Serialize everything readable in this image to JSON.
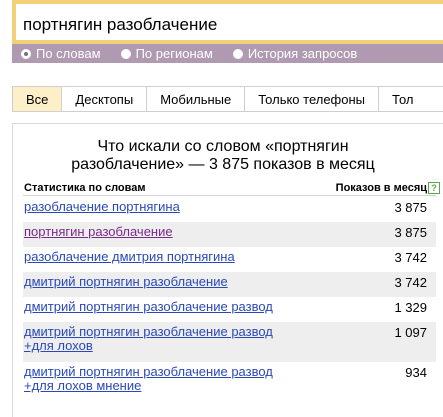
{
  "search": {
    "value": "портнягин разоблачение"
  },
  "radios": [
    {
      "label": "По словам",
      "checked": true
    },
    {
      "label": "По регионам",
      "checked": false
    },
    {
      "label": "История запросов",
      "checked": false
    }
  ],
  "tabs": [
    {
      "label": "Все",
      "active": true
    },
    {
      "label": "Десктопы",
      "active": false
    },
    {
      "label": "Мобильные",
      "active": false
    },
    {
      "label": "Только телефоны",
      "active": false
    },
    {
      "label": "Тол",
      "active": false
    }
  ],
  "panel": {
    "title": "Что искали со словом «портнягин разоблачение» — 3 875 показов в месяц",
    "col_phrase": "Статистика по словам",
    "col_count": "Показов в месяц",
    "help_icon": "?"
  },
  "rows": [
    {
      "phrase": "разоблачение портнягина",
      "count": "3 875",
      "visited": false
    },
    {
      "phrase": "портнягин разоблачение",
      "count": "3 875",
      "visited": true
    },
    {
      "phrase": "разоблачение дмитрия портнягина",
      "count": "3 742",
      "visited": false
    },
    {
      "phrase": "дмитрий портнягин разоблачение",
      "count": "3 742",
      "visited": false
    },
    {
      "phrase": "дмитрий портнягин разоблачение развод",
      "count": "1 329",
      "visited": false
    },
    {
      "phrase": "дмитрий портнягин разоблачение развод +для лохов",
      "count": "1 097",
      "visited": false
    },
    {
      "phrase": "дмитрий портнягин разоблачение развод +для лохов мнение",
      "count": "934",
      "visited": false
    }
  ],
  "colors": {
    "input_border": "#f2d079",
    "radio_bar": "#b09ab2",
    "active_tab": "#fdf0c8",
    "link": "#2a49b8",
    "visited_link": "#7a2b8a"
  }
}
